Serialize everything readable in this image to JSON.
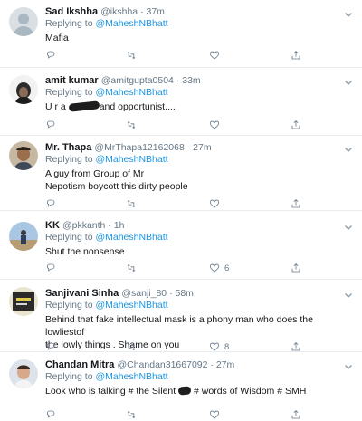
{
  "tweets": [
    {
      "name": "Sad Ikshha",
      "handle": "@ikshha",
      "time": "37m",
      "replying_prefix": "Replying to",
      "mention": "@MaheshNBhatt",
      "text_lines": [
        "Mafia"
      ],
      "likes": ""
    },
    {
      "name": "amit kumar",
      "handle": "@amitgupta0504",
      "time": "33m",
      "replying_prefix": "Replying to",
      "mention": "@MaheshNBhatt",
      "text_before": "U r a",
      "text_after": "and opportunist....",
      "likes": ""
    },
    {
      "name": "Mr. Thapa",
      "handle": "@MrThapa12162068",
      "time": "27m",
      "replying_prefix": "Replying to",
      "mention": "@MaheshNBhatt",
      "text_lines": [
        "A guy from Group of Mr",
        "Nepotism boycott this dirty people"
      ],
      "likes": ""
    },
    {
      "name": "KK",
      "handle": "@pkkanth",
      "time": "1h",
      "replying_prefix": "Replying to",
      "mention": "@MaheshNBhatt",
      "text_lines": [
        "Shut the nonsense"
      ],
      "likes": "6"
    },
    {
      "name": "Sanjivani Sinha",
      "handle": "@sanji_80",
      "time": "58m",
      "replying_prefix": "Replying to",
      "mention": "@MaheshNBhatt",
      "text_lines": [
        "Behind that fake intellectual mask is a phony man who does the lowliestof",
        "the lowly things . Shame on you"
      ],
      "likes": "8"
    },
    {
      "name": "Chandan Mitra",
      "handle": "@Chandan31667092",
      "time": "27m",
      "replying_prefix": "Replying to",
      "mention": "@MaheshNBhatt",
      "text_before": "Look who is talking # the Silent",
      "text_after": "# words of Wisdom # SMH",
      "likes": ""
    }
  ],
  "separator": " · ",
  "icons": {
    "reply": "reply-icon",
    "retweet": "retweet-icon",
    "like": "heart-icon",
    "share": "share-icon",
    "menu": "chevron-down-icon"
  },
  "colors": {
    "link": "#1b95e0",
    "muted": "#657786",
    "divider": "#e6ecf0"
  }
}
